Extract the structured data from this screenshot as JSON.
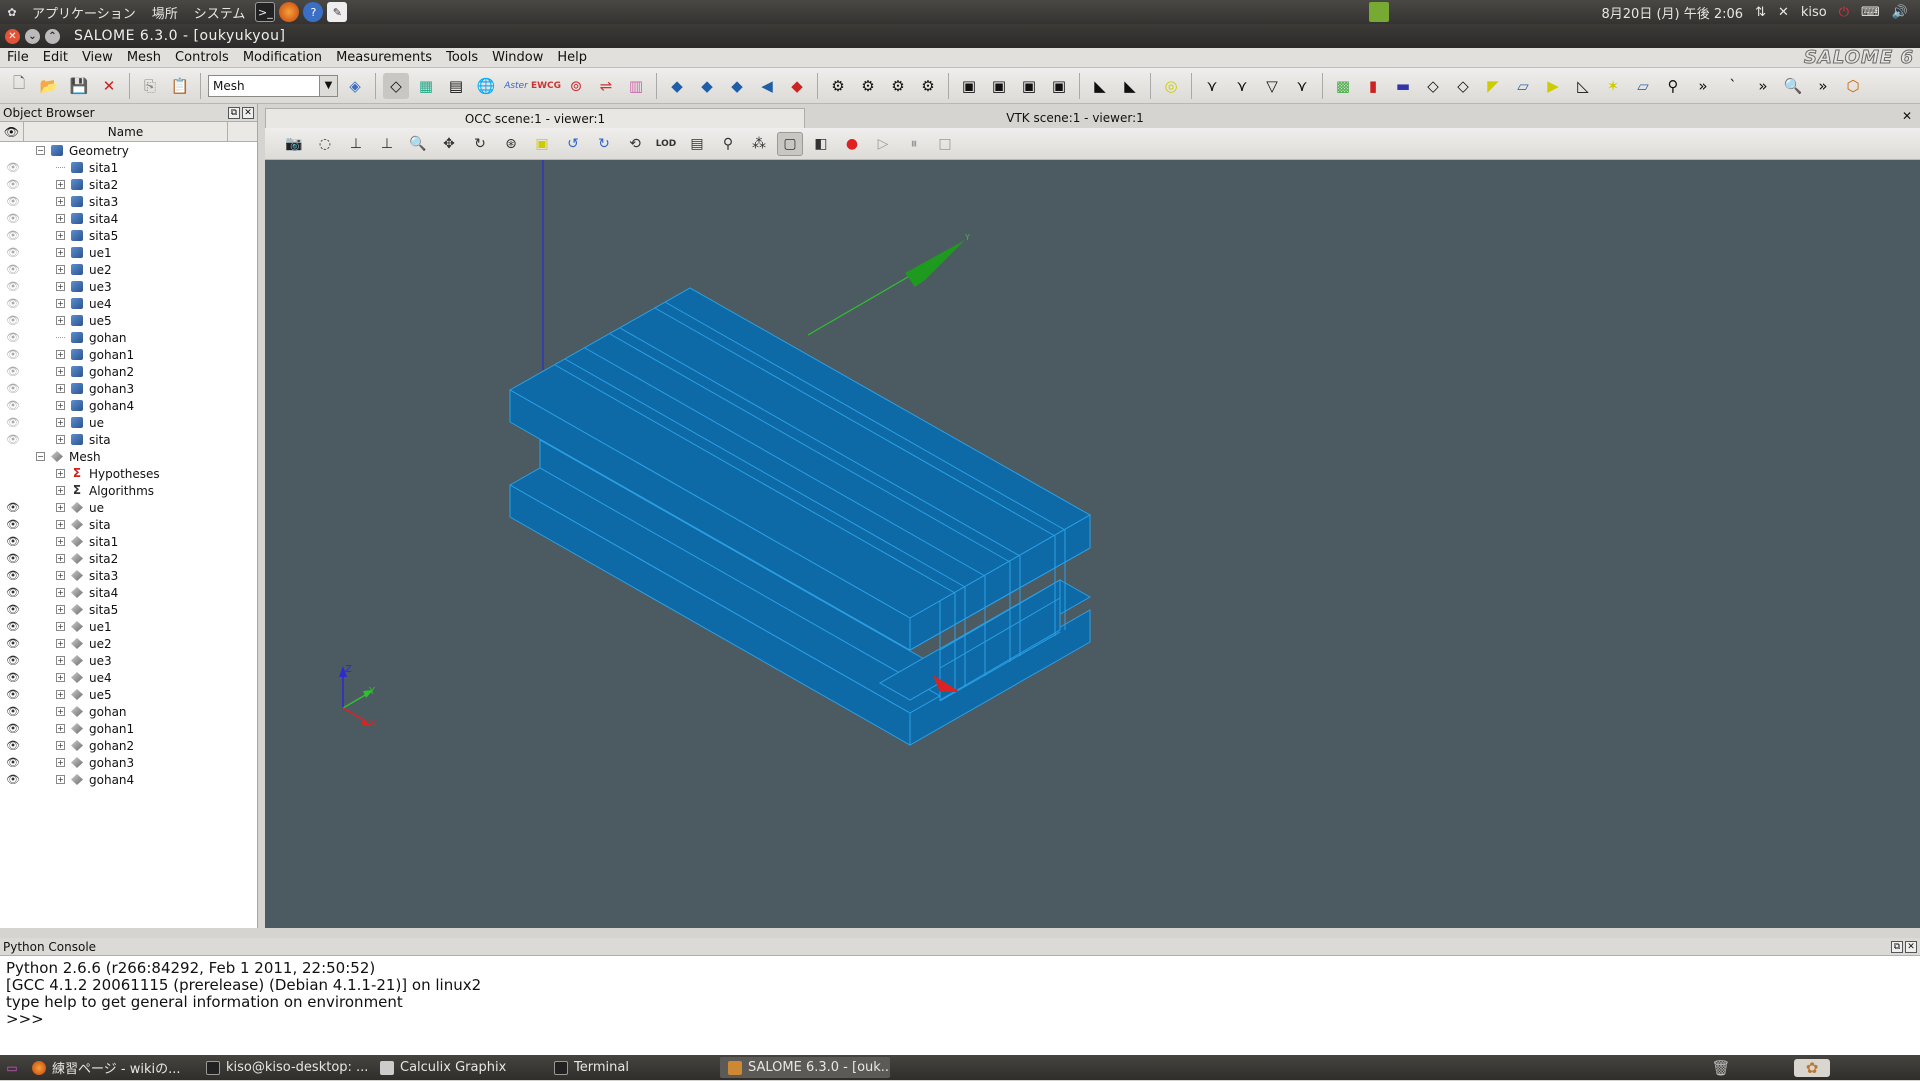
{
  "top_panel": {
    "menus": [
      "アプリケーション",
      "場所",
      "システム"
    ],
    "datetime": "8月20日 (月) 午後 2:06",
    "user": "kiso"
  },
  "window": {
    "title": "SALOME 6.3.0 - [oukyukyou]"
  },
  "menu_bar": {
    "items": [
      "File",
      "Edit",
      "View",
      "Mesh",
      "Controls",
      "Modification",
      "Measurements",
      "Tools",
      "Window",
      "Help"
    ],
    "brand": "SALOME 6"
  },
  "toolbar": {
    "module": "Mesh",
    "overflow": "»"
  },
  "object_browser": {
    "title": "Object Browser",
    "column_name": "Name",
    "geometry_label": "Geometry",
    "geometry_items": [
      "sita1",
      "sita2",
      "sita3",
      "sita4",
      "sita5",
      "ue1",
      "ue2",
      "ue3",
      "ue4",
      "ue5",
      "gohan",
      "gohan1",
      "gohan2",
      "gohan3",
      "gohan4",
      "ue",
      "sita"
    ],
    "mesh_label": "Mesh",
    "hypotheses_label": "Hypotheses",
    "algorithms_label": "Algorithms",
    "mesh_items": [
      "ue",
      "sita",
      "sita1",
      "sita2",
      "sita3",
      "sita4",
      "sita5",
      "ue1",
      "ue2",
      "ue3",
      "ue4",
      "ue5",
      "gohan",
      "gohan1",
      "gohan2",
      "gohan3",
      "gohan4"
    ]
  },
  "viewer": {
    "tab_occ": "OCC scene:1 - viewer:1",
    "tab_vtk": "VTK scene:1 - viewer:1",
    "background_color": "#4c5a62",
    "mesh_color": "#0d6aa6",
    "edge_color": "#2aa0e6"
  },
  "python_console": {
    "title": "Python Console",
    "lines": [
      "Python 2.6.6 (r266:84292, Feb  1 2011, 22:50:52)",
      "[GCC 4.1.2 20061115 (prerelease) (Debian 4.1.1-21)] on linux2",
      "type help to get general information on environment",
      ">>>"
    ]
  },
  "taskbar": {
    "tasks": [
      "練習ページ - wikiの...",
      "kiso@kiso-desktop: ...",
      "Calculix Graphix",
      "Terminal",
      "SALOME 6.3.0 - [ouk..."
    ]
  }
}
